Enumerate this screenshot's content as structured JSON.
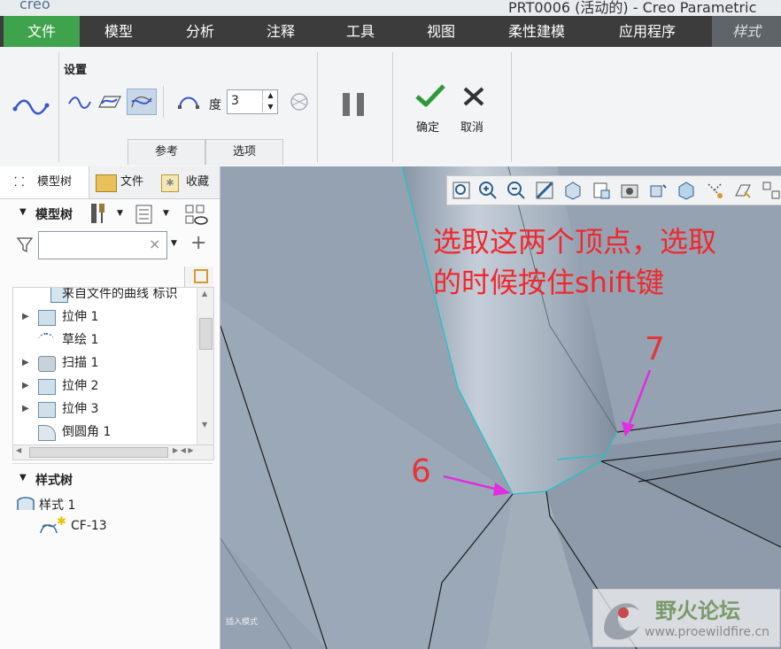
{
  "titlebar": {
    "app": "creo",
    "title": "PRT0006 (活动的) - Creo Parametric"
  },
  "menu": {
    "file": "文件",
    "model": "模型",
    "analysis": "分析",
    "annotate": "注释",
    "tools": "工具",
    "view": "视图",
    "flexible": "柔性建模",
    "apps": "应用程序",
    "style": "样式"
  },
  "ribbon": {
    "group_label": "设置",
    "degree_label": "度",
    "degree_value": "3",
    "ok_label": "确定",
    "cancel_label": "取消",
    "tab_reference": "参考",
    "tab_options": "选项"
  },
  "panel": {
    "tab_model_tree": "模型树",
    "tab_files": "文件",
    "tab_favorites": "收藏",
    "tree_header": "模型树",
    "filter_value": "",
    "items": [
      {
        "label": "来自文件的曲线 标识",
        "icon": "curve-from-file-icon",
        "expandable": false
      },
      {
        "label": "拉伸 1",
        "icon": "extrude-icon",
        "expandable": true
      },
      {
        "label": "草绘 1",
        "icon": "sketch-icon",
        "expandable": false
      },
      {
        "label": "扫描 1",
        "icon": "sweep-icon",
        "expandable": true
      },
      {
        "label": "拉伸 2",
        "icon": "extrude-icon",
        "expandable": true
      },
      {
        "label": "拉伸 3",
        "icon": "extrude-icon",
        "expandable": true
      },
      {
        "label": "倒圆角 1",
        "icon": "round-icon",
        "expandable": false
      }
    ],
    "style_tree_header": "样式树",
    "style_items": [
      {
        "label": "样式 1"
      },
      {
        "label": "CF-13"
      }
    ]
  },
  "viewport": {
    "annotation_line1": "选取这两个顶点，选取",
    "annotation_line2": "的时候按住shift键",
    "vertex_a": "7",
    "vertex_b": "6",
    "insert_mode": "插入模式",
    "watermark_title": "野火论坛",
    "watermark_url": "www.proewildfire.cn"
  },
  "colors": {
    "accent_green": "#3fa34d",
    "annotation_red": "#f0282d",
    "arrow_magenta": "#e02ee0",
    "edge_cyan": "#22c3c8"
  }
}
